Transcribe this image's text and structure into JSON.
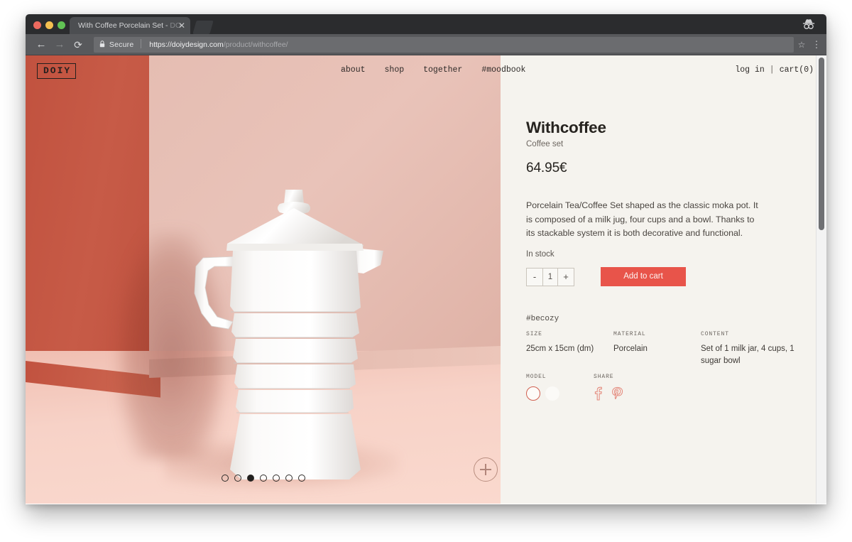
{
  "browser": {
    "tab_title": "With Coffee Porcelain Set - ",
    "tab_title_dim": "DO",
    "close_icon": "close-icon",
    "incognito_icon": "incognito-icon",
    "back_icon": "←",
    "forward_icon": "→",
    "reload_icon": "⟳",
    "lock_icon": "🔒",
    "secure_label": "Secure",
    "url_host": "https://doiydesign.com",
    "url_path": "/product/withcoffee/",
    "star_icon": "☆",
    "menu_icon": "⋮"
  },
  "site_header": {
    "logo": "DOIY",
    "nav_items": [
      {
        "label": "about"
      },
      {
        "label": "shop"
      },
      {
        "label": "together"
      },
      {
        "label": "#moodbook"
      }
    ],
    "account": {
      "login_label": "log in",
      "separator": "|",
      "cart_label": "cart(0)"
    }
  },
  "gallery": {
    "dots_total": 7,
    "active_dot_index": 2,
    "zoom_button": "zoom-in-button",
    "colors": {
      "wall_left": "#c45a48",
      "wall_right": "#e6c0b5",
      "floor": "#f6cfc4",
      "product": "#ffffff"
    }
  },
  "product": {
    "title": "Withcoffee",
    "subtitle": "Coffee set",
    "price": "64.95€",
    "description": "Porcelain Tea/Coffee Set shaped as the classic moka pot. It is composed of a milk jug, four cups and a bowl. Thanks to its stackable system it is both decorative and functional.",
    "stock_status": "In stock",
    "quantity": {
      "decrement_label": "-",
      "value": "1",
      "increment_label": "+"
    },
    "add_to_cart_label": "Add to cart",
    "add_to_cart_color": "#e8544a",
    "hashtag": "#becozy",
    "specs": [
      {
        "label": "SIZE",
        "value": "25cm x 15cm (dm)"
      },
      {
        "label": "MATERIAL",
        "value": "Porcelain"
      },
      {
        "label": "CONTENT",
        "value": "Set of 1 milk jar, 4 cups, 1 sugar bowl"
      }
    ],
    "model": {
      "label": "MODEL",
      "swatches": [
        {
          "name": "white-outlined",
          "selected": true
        },
        {
          "name": "white-plain",
          "selected": false
        }
      ]
    },
    "share": {
      "label": "SHARE",
      "icons": [
        {
          "name": "facebook-icon"
        },
        {
          "name": "pinterest-icon"
        }
      ]
    }
  }
}
